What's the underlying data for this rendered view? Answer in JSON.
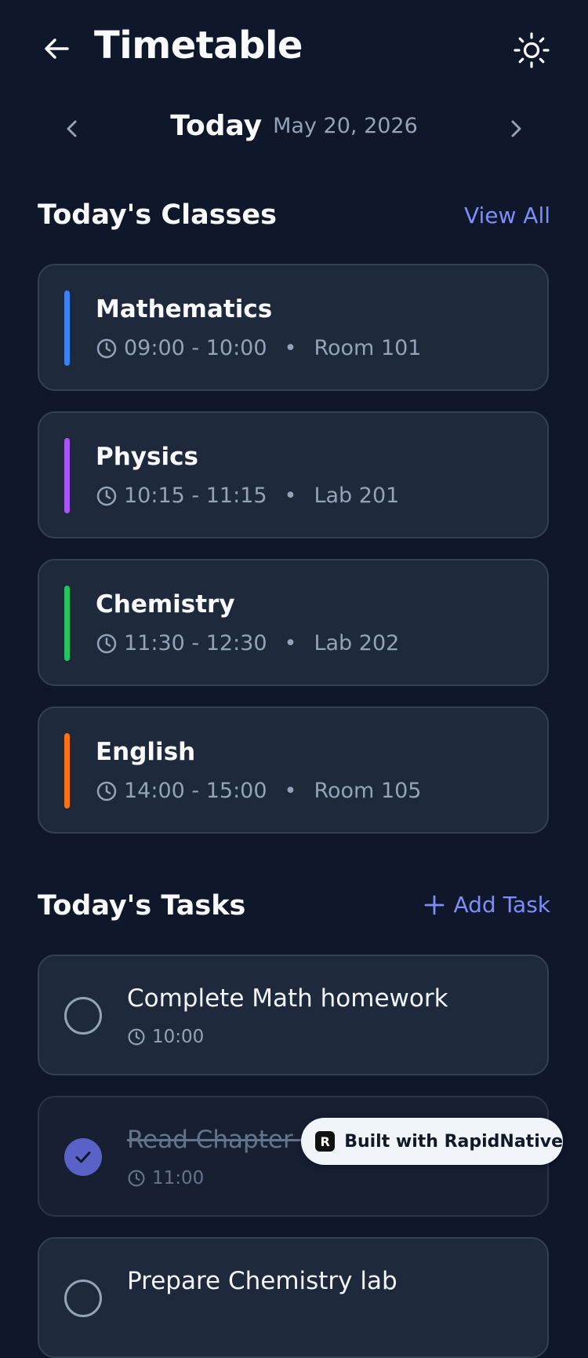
{
  "header": {
    "title": "Timetable",
    "back_icon": "arrow-left-icon",
    "theme_icon": "sun-icon"
  },
  "date_nav": {
    "today_label": "Today",
    "date": "May 20, 2026",
    "prev_icon": "chevron-left-icon",
    "next_icon": "chevron-right-icon"
  },
  "classes_section": {
    "title": "Today's Classes",
    "view_all": "View All",
    "items": [
      {
        "name": "Mathematics",
        "time": "09:00 - 10:00",
        "separator": "•",
        "location": "Room 101",
        "color": "#3b82f6"
      },
      {
        "name": "Physics",
        "time": "10:15 - 11:15",
        "separator": "•",
        "location": "Lab 201",
        "color": "#a855f7"
      },
      {
        "name": "Chemistry",
        "time": "11:30 - 12:30",
        "separator": "•",
        "location": "Lab 202",
        "color": "#22c55e"
      },
      {
        "name": "English",
        "time": "14:00 - 15:00",
        "separator": "•",
        "location": "Room 105",
        "color": "#f97316"
      }
    ]
  },
  "tasks_section": {
    "title": "Today's Tasks",
    "add_task": "Add Task",
    "items": [
      {
        "title": "Complete Math homework",
        "time": "10:00",
        "completed": false
      },
      {
        "title": "Read Chapter 5",
        "time": "11:00",
        "completed": true
      },
      {
        "title": "Prepare Chemistry lab",
        "time": "",
        "completed": false
      }
    ]
  },
  "badge": {
    "text": "Built with RapidNative",
    "logo_letter": "R"
  },
  "colors": {
    "background": "#0f172a",
    "card": "#1e293b",
    "accent": "#818cf8",
    "check_done": "#5b62c7"
  }
}
